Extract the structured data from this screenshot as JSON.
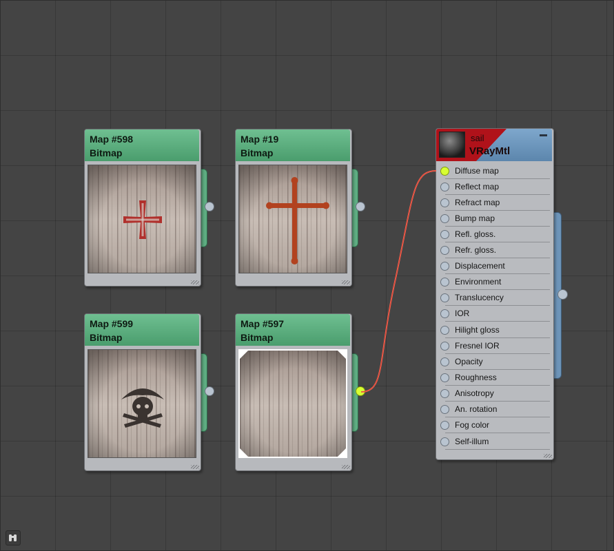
{
  "colors": {
    "map_header": "#5aae7e",
    "material_header": "#6d94b8",
    "active_port": "#d8ff33",
    "wire": "#e0453b",
    "canvas": "#444444"
  },
  "map_nodes": [
    {
      "name": "Map #598",
      "type": "Bitmap",
      "emblem": "cross-pattee",
      "selected": false,
      "connected": false
    },
    {
      "name": "Map #19",
      "type": "Bitmap",
      "emblem": "cross-bottony",
      "selected": false,
      "connected": false
    },
    {
      "name": "Map #599",
      "type": "Bitmap",
      "emblem": "skull-pirate",
      "selected": false,
      "connected": false
    },
    {
      "name": "Map #597",
      "type": "Bitmap",
      "emblem": "none",
      "selected": true,
      "connected": true
    }
  ],
  "material": {
    "name": "sail",
    "type": "VRayMtl",
    "slots": [
      {
        "label": "Diffuse map",
        "connected": true
      },
      {
        "label": "Reflect map",
        "connected": false
      },
      {
        "label": "Refract map",
        "connected": false
      },
      {
        "label": "Bump map",
        "connected": false
      },
      {
        "label": "Refl. gloss.",
        "connected": false
      },
      {
        "label": "Refr. gloss.",
        "connected": false
      },
      {
        "label": "Displacement",
        "connected": false
      },
      {
        "label": "Environment",
        "connected": false
      },
      {
        "label": "Translucency",
        "connected": false
      },
      {
        "label": "IOR",
        "connected": false
      },
      {
        "label": "Hilight gloss",
        "connected": false
      },
      {
        "label": "Fresnel IOR",
        "connected": false
      },
      {
        "label": "Opacity",
        "connected": false
      },
      {
        "label": "Roughness",
        "connected": false
      },
      {
        "label": "Anisotropy",
        "connected": false
      },
      {
        "label": "An. rotation",
        "connected": false
      },
      {
        "label": "Fog color",
        "connected": false
      },
      {
        "label": "Self-illum",
        "connected": false
      }
    ]
  },
  "connection": {
    "from": "Map #597",
    "to": "Diffuse map"
  },
  "icons": {
    "corner_button": "binoculars-icon",
    "material_minimize": "minimize-icon"
  }
}
